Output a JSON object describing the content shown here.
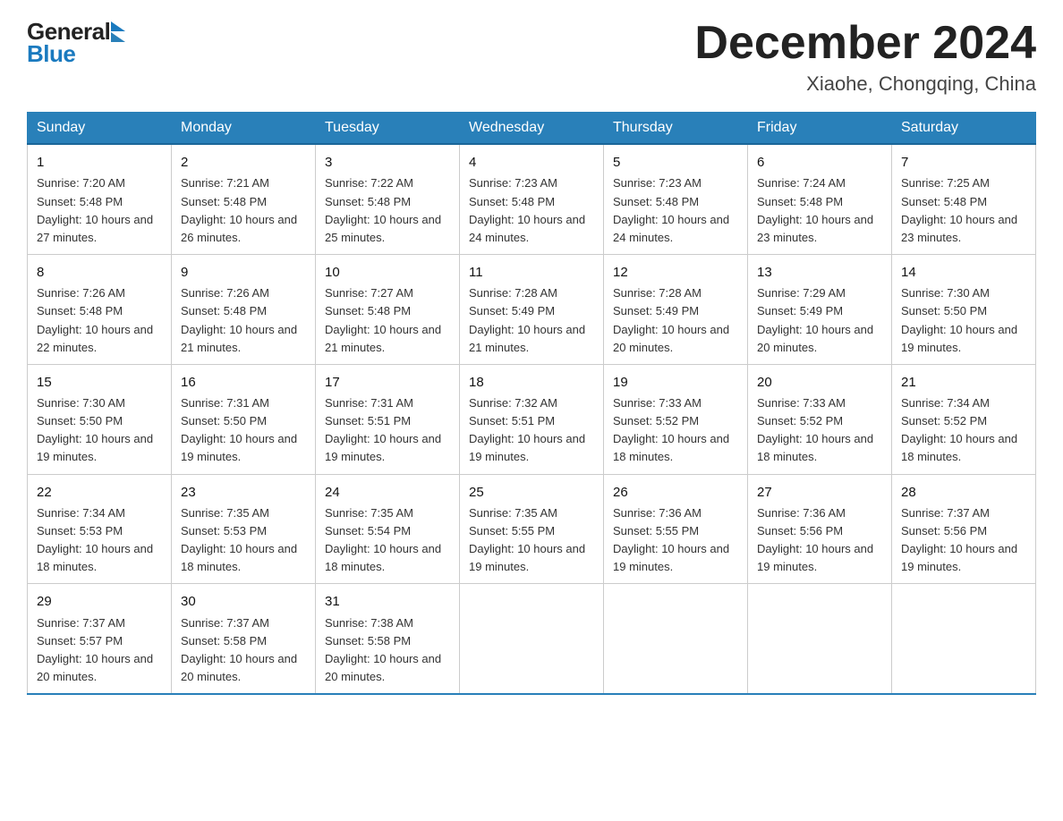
{
  "header": {
    "month_year": "December 2024",
    "location": "Xiaohe, Chongqing, China",
    "logo_general": "General",
    "logo_blue": "Blue"
  },
  "days_of_week": [
    "Sunday",
    "Monday",
    "Tuesday",
    "Wednesday",
    "Thursday",
    "Friday",
    "Saturday"
  ],
  "weeks": [
    [
      {
        "day": "1",
        "sunrise": "7:20 AM",
        "sunset": "5:48 PM",
        "daylight": "10 hours and 27 minutes."
      },
      {
        "day": "2",
        "sunrise": "7:21 AM",
        "sunset": "5:48 PM",
        "daylight": "10 hours and 26 minutes."
      },
      {
        "day": "3",
        "sunrise": "7:22 AM",
        "sunset": "5:48 PM",
        "daylight": "10 hours and 25 minutes."
      },
      {
        "day": "4",
        "sunrise": "7:23 AM",
        "sunset": "5:48 PM",
        "daylight": "10 hours and 24 minutes."
      },
      {
        "day": "5",
        "sunrise": "7:23 AM",
        "sunset": "5:48 PM",
        "daylight": "10 hours and 24 minutes."
      },
      {
        "day": "6",
        "sunrise": "7:24 AM",
        "sunset": "5:48 PM",
        "daylight": "10 hours and 23 minutes."
      },
      {
        "day": "7",
        "sunrise": "7:25 AM",
        "sunset": "5:48 PM",
        "daylight": "10 hours and 23 minutes."
      }
    ],
    [
      {
        "day": "8",
        "sunrise": "7:26 AM",
        "sunset": "5:48 PM",
        "daylight": "10 hours and 22 minutes."
      },
      {
        "day": "9",
        "sunrise": "7:26 AM",
        "sunset": "5:48 PM",
        "daylight": "10 hours and 21 minutes."
      },
      {
        "day": "10",
        "sunrise": "7:27 AM",
        "sunset": "5:48 PM",
        "daylight": "10 hours and 21 minutes."
      },
      {
        "day": "11",
        "sunrise": "7:28 AM",
        "sunset": "5:49 PM",
        "daylight": "10 hours and 21 minutes."
      },
      {
        "day": "12",
        "sunrise": "7:28 AM",
        "sunset": "5:49 PM",
        "daylight": "10 hours and 20 minutes."
      },
      {
        "day": "13",
        "sunrise": "7:29 AM",
        "sunset": "5:49 PM",
        "daylight": "10 hours and 20 minutes."
      },
      {
        "day": "14",
        "sunrise": "7:30 AM",
        "sunset": "5:50 PM",
        "daylight": "10 hours and 19 minutes."
      }
    ],
    [
      {
        "day": "15",
        "sunrise": "7:30 AM",
        "sunset": "5:50 PM",
        "daylight": "10 hours and 19 minutes."
      },
      {
        "day": "16",
        "sunrise": "7:31 AM",
        "sunset": "5:50 PM",
        "daylight": "10 hours and 19 minutes."
      },
      {
        "day": "17",
        "sunrise": "7:31 AM",
        "sunset": "5:51 PM",
        "daylight": "10 hours and 19 minutes."
      },
      {
        "day": "18",
        "sunrise": "7:32 AM",
        "sunset": "5:51 PM",
        "daylight": "10 hours and 19 minutes."
      },
      {
        "day": "19",
        "sunrise": "7:33 AM",
        "sunset": "5:52 PM",
        "daylight": "10 hours and 18 minutes."
      },
      {
        "day": "20",
        "sunrise": "7:33 AM",
        "sunset": "5:52 PM",
        "daylight": "10 hours and 18 minutes."
      },
      {
        "day": "21",
        "sunrise": "7:34 AM",
        "sunset": "5:52 PM",
        "daylight": "10 hours and 18 minutes."
      }
    ],
    [
      {
        "day": "22",
        "sunrise": "7:34 AM",
        "sunset": "5:53 PM",
        "daylight": "10 hours and 18 minutes."
      },
      {
        "day": "23",
        "sunrise": "7:35 AM",
        "sunset": "5:53 PM",
        "daylight": "10 hours and 18 minutes."
      },
      {
        "day": "24",
        "sunrise": "7:35 AM",
        "sunset": "5:54 PM",
        "daylight": "10 hours and 18 minutes."
      },
      {
        "day": "25",
        "sunrise": "7:35 AM",
        "sunset": "5:55 PM",
        "daylight": "10 hours and 19 minutes."
      },
      {
        "day": "26",
        "sunrise": "7:36 AM",
        "sunset": "5:55 PM",
        "daylight": "10 hours and 19 minutes."
      },
      {
        "day": "27",
        "sunrise": "7:36 AM",
        "sunset": "5:56 PM",
        "daylight": "10 hours and 19 minutes."
      },
      {
        "day": "28",
        "sunrise": "7:37 AM",
        "sunset": "5:56 PM",
        "daylight": "10 hours and 19 minutes."
      }
    ],
    [
      {
        "day": "29",
        "sunrise": "7:37 AM",
        "sunset": "5:57 PM",
        "daylight": "10 hours and 20 minutes."
      },
      {
        "day": "30",
        "sunrise": "7:37 AM",
        "sunset": "5:58 PM",
        "daylight": "10 hours and 20 minutes."
      },
      {
        "day": "31",
        "sunrise": "7:38 AM",
        "sunset": "5:58 PM",
        "daylight": "10 hours and 20 minutes."
      },
      null,
      null,
      null,
      null
    ]
  ],
  "labels": {
    "sunrise": "Sunrise:",
    "sunset": "Sunset:",
    "daylight": "Daylight:"
  }
}
